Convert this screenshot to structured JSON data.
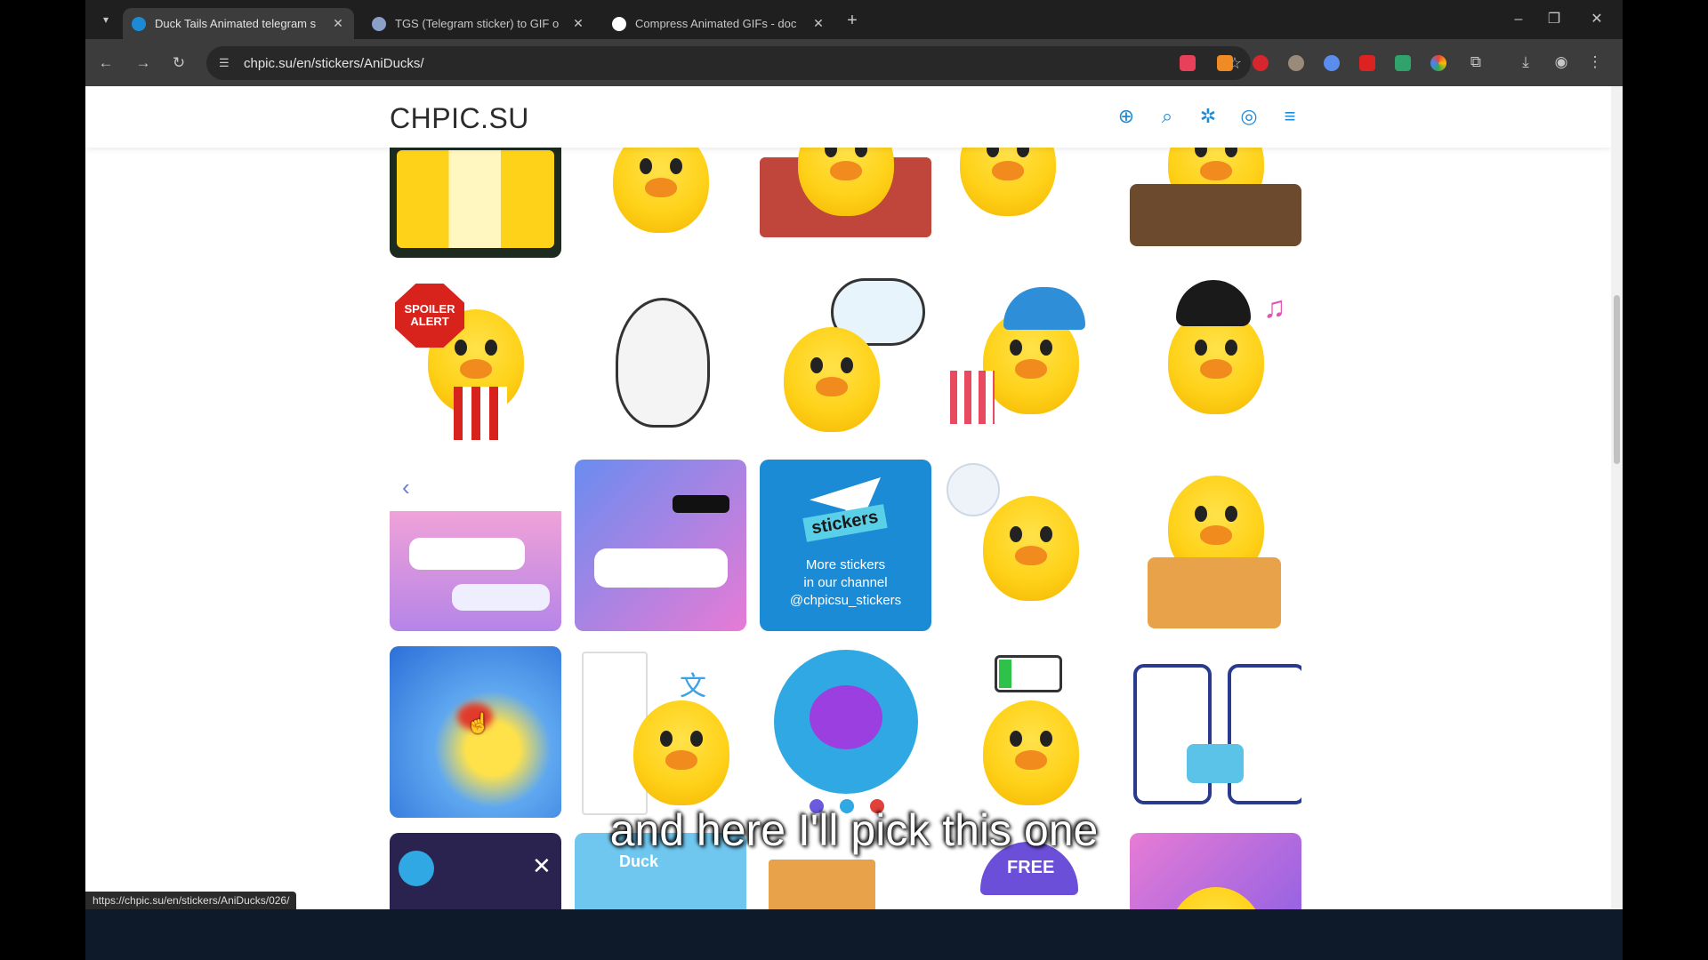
{
  "browser": {
    "tabs": [
      {
        "title": "Duck Tails Animated telegram s",
        "favicon_color": "#1c8bd6",
        "active": true
      },
      {
        "title": "TGS (Telegram sticker) to GIF o",
        "favicon_color": "#8aa0c8",
        "active": false
      },
      {
        "title": "Compress Animated GIFs - doc",
        "favicon_color": "#ffffff",
        "active": false
      }
    ],
    "address": "chpic.su/en/stickers/AniDucks/",
    "status_url": "https://chpic.su/en/stickers/AniDucks/026/"
  },
  "site": {
    "logo": "CHPIC.SU",
    "accent_color": "#1c8bd6",
    "header_icons": [
      "add-circle-icon",
      "search-icon",
      "bug-icon",
      "account-icon",
      "menu-icon"
    ]
  },
  "stickers": {
    "promo": {
      "badge": "stickers",
      "line1": "More stickers",
      "line2": "in our channel",
      "handle": "@chpicsu_stickers"
    },
    "spoiler_sign": "SPOILER ALERT",
    "free_label": "FREE",
    "duck_label": "Duck"
  },
  "caption": "and here I'll pick this one"
}
